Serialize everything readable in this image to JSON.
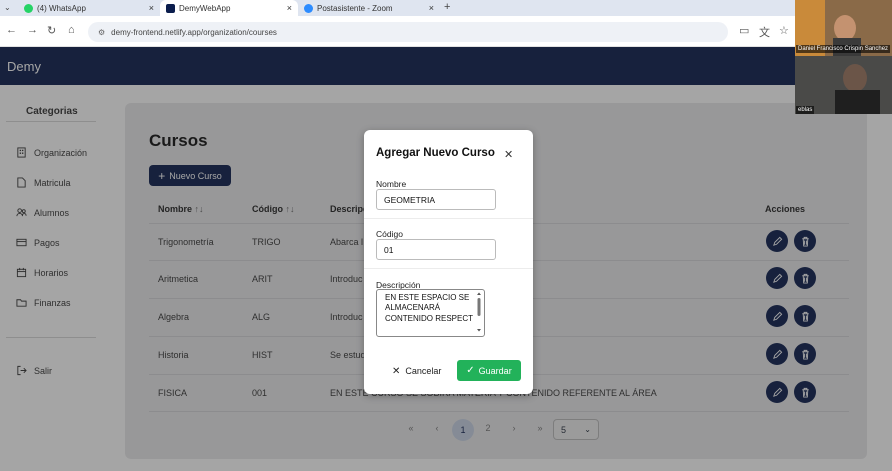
{
  "browser": {
    "tabs": [
      {
        "title": "(4) WhatsApp",
        "color": "#25D366"
      },
      {
        "title": "DemyWebApp",
        "color": "#0b1d4d"
      },
      {
        "title": "Postasistente - Zoom",
        "color": "#2D8CFF"
      }
    ],
    "url": "demy-frontend.netlify.app/organization/courses"
  },
  "app": {
    "brand": "Demy"
  },
  "sidebar": {
    "title": "Categorias",
    "items": [
      {
        "label": "Organización",
        "icon": "building-icon"
      },
      {
        "label": "Matricula",
        "icon": "document-icon"
      },
      {
        "label": "Alumnos",
        "icon": "users-icon"
      },
      {
        "label": "Pagos",
        "icon": "card-icon"
      },
      {
        "label": "Horarios",
        "icon": "calendar-icon"
      },
      {
        "label": "Finanzas",
        "icon": "folder-icon"
      }
    ],
    "logout": "Salir"
  },
  "main": {
    "title": "Cursos",
    "new_button": "Nuevo Curso",
    "headers": {
      "name": "Nombre",
      "code": "Código",
      "description": "Descripción",
      "actions": "Acciones"
    },
    "sort_glyph": "↑↓",
    "rows": [
      {
        "name": "Trigonometría",
        "code": "TRIGO",
        "description": "Abarca l"
      },
      {
        "name": "Aritmetica",
        "code": "ARIT",
        "description": "Introduc"
      },
      {
        "name": "Algebra",
        "code": "ALG",
        "description": "Introduc"
      },
      {
        "name": "Historia",
        "code": "HIST",
        "description": "Se estud"
      },
      {
        "name": "FISICA",
        "code": "001",
        "description": "EN ESTE CURSO SE SOBIRA MATERIA Y CONTENIDO REFERENTE AL ÁREA"
      }
    ],
    "pagination": {
      "first": "«",
      "prev": "‹",
      "pages": [
        "1",
        "2"
      ],
      "current": "1",
      "next": "›",
      "last": "»",
      "page_size": "5"
    }
  },
  "modal": {
    "title": "Agregar Nuevo Curso",
    "name_label": "Nombre",
    "name_value": "GEOMETRIA",
    "code_label": "Código",
    "code_value": "01",
    "desc_label": "Descripción",
    "desc_value": "EN ESTE ESPACIO SE ALMACENARÁ CONTENIDO RESPECT",
    "cancel": "Cancelar",
    "save": "Guardar"
  },
  "video": {
    "participant_1": "Daniel Francisco Crispin Sanchez",
    "participant_2": "eblas"
  },
  "colors": {
    "navy": "#0b1d4d",
    "save_green": "#22b25a",
    "overlay": "rgba(40,40,40,0.42)"
  }
}
